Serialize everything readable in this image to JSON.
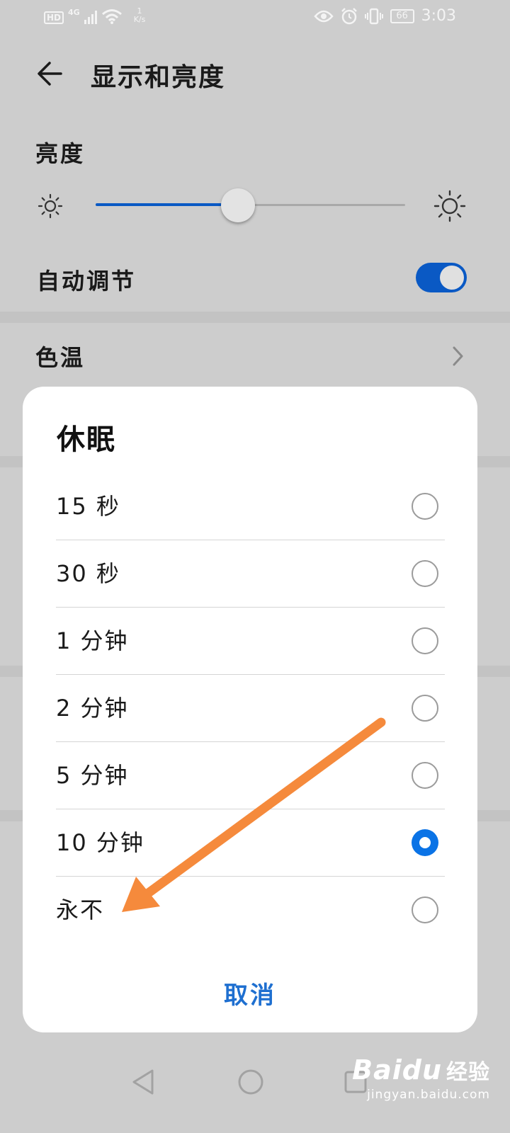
{
  "status_bar": {
    "hd": "HD",
    "network_type": "4G",
    "speed_value": "1",
    "speed_unit": "K/s",
    "battery": "66",
    "time": "3:03"
  },
  "header": {
    "title": "显示和亮度",
    "back_icon": "arrow-left-icon"
  },
  "brightness": {
    "label": "亮度",
    "level": 0.46,
    "low_icon": "sun-small-icon",
    "high_icon": "sun-large-icon"
  },
  "auto_adjust": {
    "label": "自动调节",
    "enabled": true
  },
  "color_temperature": {
    "label": "色温",
    "chevron_icon": "chevron-right-icon"
  },
  "sleep_dialog": {
    "title": "休眠",
    "options": [
      {
        "label": "15 秒",
        "selected": false
      },
      {
        "label": "30 秒",
        "selected": false
      },
      {
        "label": "1 分钟",
        "selected": false
      },
      {
        "label": "2 分钟",
        "selected": false
      },
      {
        "label": "5 分钟",
        "selected": false
      },
      {
        "label": "10 分钟",
        "selected": true
      },
      {
        "label": "永不",
        "selected": false
      }
    ],
    "cancel_label": "取消"
  },
  "annotation": {
    "color": "#f58a3c"
  },
  "colors": {
    "accent": "#0a59c4",
    "radio_selected": "#0a73e6",
    "cancel_text": "#1e6fd0"
  },
  "nav_bar": {
    "back": "triangle-back-icon",
    "home": "circle-home-icon",
    "recents": "square-recents-icon"
  },
  "watermark": {
    "logo": "Baidu",
    "logo_cn": "经验",
    "url": "jingyan.baidu.com"
  }
}
